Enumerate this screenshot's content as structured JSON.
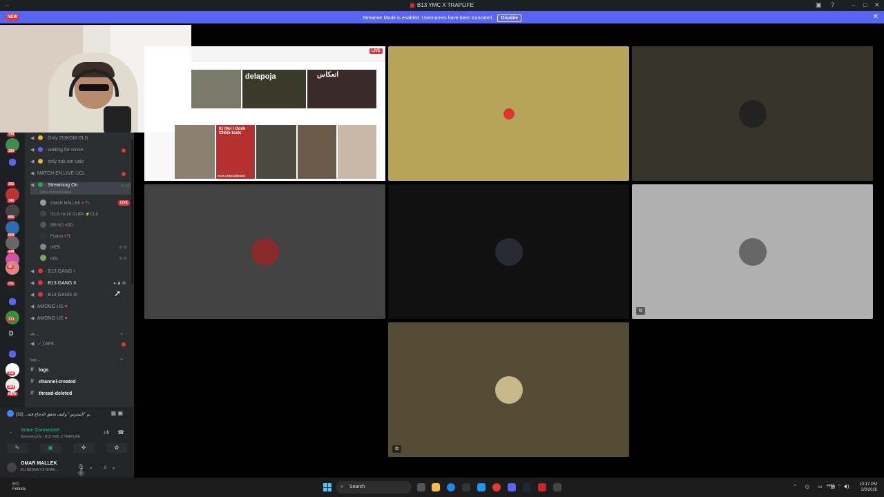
{
  "window": {
    "title": "B13 YMC X TRAPLIFE",
    "new_badge": "NEW"
  },
  "banner": {
    "message": "Streamer Mode is enabled. Usernames have been truncated.",
    "disable_label": "Disable"
  },
  "guild_badges": [
    "139",
    "360",
    "292",
    "346",
    "805",
    "600",
    "448",
    "40",
    "211",
    "373",
    "116",
    "304",
    "NEW"
  ],
  "guild_letter": "D",
  "channels": [
    {
      "name": "Only ZOKOM OLD",
      "emoji_color": "#f0b232"
    },
    {
      "name": "waiting for move",
      "emoji_color": "#5865f2",
      "unread": true
    },
    {
      "name": "only zok om valo",
      "emoji_color": "#f0b232"
    },
    {
      "name": "MATCH EN LIVE UCL",
      "unread": true
    }
  ],
  "active_channel": {
    "name": "Streaming On",
    "timer": "41:25",
    "status": "Set a channel status"
  },
  "members": [
    {
      "name": "OMAR MALLEK",
      "tag": "TL",
      "live": "LIVE"
    },
    {
      "name": "!CLS ᴛᴍ LII CLIPA",
      "tag": "CLS"
    },
    {
      "name": "ᗷᗷ ᖇᗝ",
      "tag": "DD"
    },
    {
      "name": "Fusion",
      "tag": "TL"
    },
    {
      "name": "IHEB"
    },
    {
      "name": "rafa"
    }
  ],
  "voice_channels_2": [
    {
      "name": "B13 GANG I"
    },
    {
      "name": "B13 GANG II",
      "active": true
    },
    {
      "name": "B13 GANG III"
    },
    {
      "name": "AMONG US"
    },
    {
      "name": "AMONG US"
    }
  ],
  "afk_category": "afk",
  "afk_channel": "AFK",
  "logs_category": "logs",
  "text_channels": [
    "logs",
    "channel-created",
    "thread-deleted"
  ],
  "panel": {
    "activity": "(32) ...ـم \"السترس\" وكيف تحقق الدجاج فيه",
    "voice_connected": "Voice Connected",
    "voice_channel": "Streaming On / B13 YMC X TRAPLIFE",
    "username": "OMAR MALLEK",
    "user_sub": "ELI BEDNA YJI NHAR ..."
  },
  "screenshare": {
    "live": "LIVE",
    "thumb_text_1": "delapoja",
    "thumb_text_2": "انعكاس",
    "thumb_text_3": "Ki t9ol l Omik Chbik toxic",
    "thumb_text_4": "KICK.COM/ZANOUNI"
  },
  "tiles_colors": {
    "tile1": "#b7a45a",
    "tile2": "#36332a",
    "tile3": "#424242",
    "tile4": "#111111",
    "tile5": "#b0b0b0",
    "tile6": "#544c35"
  },
  "taskbar": {
    "weather_temp": "5°C",
    "weather_desc": "Fellnds",
    "search": "Search",
    "lang": "FRA",
    "time": "10:17 PM",
    "date": "2/9/2026"
  }
}
